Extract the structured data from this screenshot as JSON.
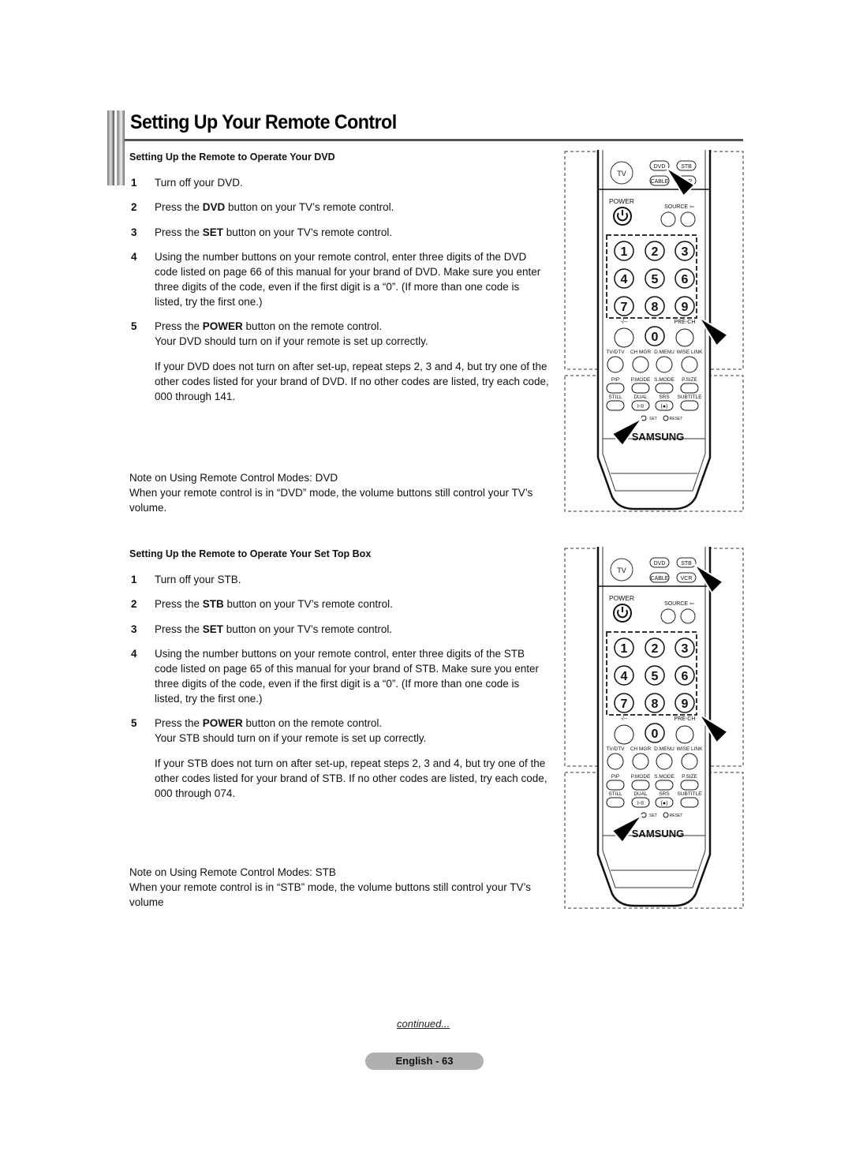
{
  "page": {
    "title": "Setting Up Your Remote Control",
    "continued": "continued...",
    "page_label": "English - 63"
  },
  "dvd_section": {
    "heading": "Setting Up the Remote to Operate Your DVD",
    "steps": [
      {
        "num": "1",
        "pre": "Turn off your DVD.",
        "bold": "",
        "post": ""
      },
      {
        "num": "2",
        "pre": "Press the ",
        "bold": "DVD",
        "post": " button on your TV’s remote control."
      },
      {
        "num": "3",
        "pre": "Press the ",
        "bold": "SET",
        "post": " button on your TV’s remote control."
      },
      {
        "num": "4",
        "pre": "Using the number buttons on your remote control, enter three digits of the DVD code listed on page 66 of this manual for your brand of DVD. Make sure you enter three digits of the code, even if the first digit is a “0”. (If more than one code is listed, try the first one.)",
        "bold": "",
        "post": ""
      },
      {
        "num": "5",
        "pre": "Press the ",
        "bold": "POWER",
        "post": " button on the remote control.",
        "line2": "Your DVD should turn on if your remote is set up correctly."
      }
    ],
    "retry": "If your DVD does not turn on after set-up, repeat steps 2, 3 and 4, but try one of the other codes listed for your brand of DVD. If no other codes are listed, try each code, 000 through 141.",
    "note_title": "Note on Using Remote Control Modes: DVD",
    "note_body": "When your remote control is in “DVD” mode, the volume buttons still control your TV’s volume."
  },
  "stb_section": {
    "heading": "Setting Up the Remote to Operate Your Set Top Box",
    "steps": [
      {
        "num": "1",
        "pre": "Turn off your STB.",
        "bold": "",
        "post": ""
      },
      {
        "num": "2",
        "pre": "Press the ",
        "bold": "STB",
        "post": " button on your TV’s remote control."
      },
      {
        "num": "3",
        "pre": "Press the ",
        "bold": "SET",
        "post": " button on your TV’s remote control."
      },
      {
        "num": "4",
        "pre": "Using the number buttons on your remote control, enter three digits of the STB code listed on page 65 of this manual for your brand of STB. Make sure you enter three digits of the code, even if the first digit is a “0”. (If more than one code is listed, try the first one.)",
        "bold": "",
        "post": ""
      },
      {
        "num": "5",
        "pre": "Press the ",
        "bold": "POWER",
        "post": " button on the remote control.",
        "line2": "Your STB should turn on if your remote is set up correctly."
      }
    ],
    "retry": "If your STB does not turn on after set-up, repeat steps 2, 3 and 4, but try one of the other codes listed for your brand of STB. If no other codes are listed, try each code, 000 through 074.",
    "note_title": "Note on Using Remote Control Modes: STB",
    "note_body": "When your remote control is in “STB” mode, the volume buttons still control your TV’s volume"
  },
  "remote": {
    "tv": "TV",
    "dvd": "DVD",
    "stb": "STB",
    "cable": "CABLE",
    "vcr": "VCR",
    "power": "POWER",
    "source": "SOURCE",
    "digits": [
      "1",
      "2",
      "3",
      "4",
      "5",
      "6",
      "7",
      "8",
      "9",
      "0"
    ],
    "dash": "-/--",
    "prech": "PRE-CH",
    "row_labels": [
      "TV/DTV",
      "CH MGR",
      "D.MENU",
      "WISE LINK"
    ],
    "row2_labels": [
      "PIP",
      "P.MODE",
      "S.MODE",
      "P.SIZE"
    ],
    "row3_labels": [
      "STILL",
      "DUAL",
      "SRS",
      "SUBTITLE"
    ],
    "dual_button": "I-II",
    "srs_button": "(●)",
    "set": "SET",
    "reset": "RESET",
    "brand": "SAMSUNG"
  }
}
